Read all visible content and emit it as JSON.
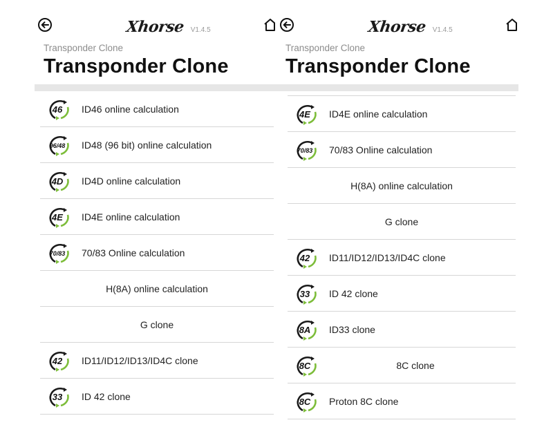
{
  "brand": {
    "logo": "Xhorse",
    "version": "V1.4.5"
  },
  "left": {
    "breadcrumb": "Transponder Clone",
    "title": "Transponder Clone",
    "items": [
      {
        "icon": "46",
        "label": "ID46 online calculation",
        "centered": false,
        "has_icon": true
      },
      {
        "icon": "96/48",
        "label": "ID48 (96 bit) online calculation",
        "centered": false,
        "has_icon": true
      },
      {
        "icon": "4D",
        "label": "ID4D online calculation",
        "centered": false,
        "has_icon": true
      },
      {
        "icon": "4E",
        "label": "ID4E online calculation",
        "centered": false,
        "has_icon": true
      },
      {
        "icon": "70/83",
        "label": "70/83 Online calculation",
        "centered": false,
        "has_icon": true
      },
      {
        "icon": "",
        "label": "H(8A) online calculation",
        "centered": true,
        "has_icon": false
      },
      {
        "icon": "",
        "label": "G clone",
        "centered": true,
        "has_icon": false
      },
      {
        "icon": "42",
        "label": "ID11/ID12/ID13/ID4C clone",
        "centered": false,
        "has_icon": true
      },
      {
        "icon": "33",
        "label": "ID 42 clone",
        "centered": false,
        "has_icon": true
      }
    ]
  },
  "right": {
    "breadcrumb": "Transponder Clone",
    "title": "Transponder Clone",
    "items": [
      {
        "icon": "4E",
        "label": "ID4E online calculation",
        "centered": false,
        "has_icon": true
      },
      {
        "icon": "70/83",
        "label": "70/83 Online calculation",
        "centered": false,
        "has_icon": true
      },
      {
        "icon": "",
        "label": "H(8A) online calculation",
        "centered": true,
        "has_icon": false
      },
      {
        "icon": "",
        "label": "G clone",
        "centered": true,
        "has_icon": false
      },
      {
        "icon": "42",
        "label": "ID11/ID12/ID13/ID4C clone",
        "centered": false,
        "has_icon": true
      },
      {
        "icon": "33",
        "label": "ID 42 clone",
        "centered": false,
        "has_icon": true
      },
      {
        "icon": "8A",
        "label": "ID33 clone",
        "centered": false,
        "has_icon": true
      },
      {
        "icon": "8C",
        "label": "8C clone",
        "centered": true,
        "has_icon": true
      },
      {
        "icon": "8C",
        "label": "Proton 8C clone",
        "centered": false,
        "has_icon": true
      }
    ]
  },
  "colors": {
    "accent_green": "#7dbd3a",
    "ring_dark": "#1a1a1a",
    "divider": "#d6d6d6",
    "band": "#e6e6e6"
  }
}
